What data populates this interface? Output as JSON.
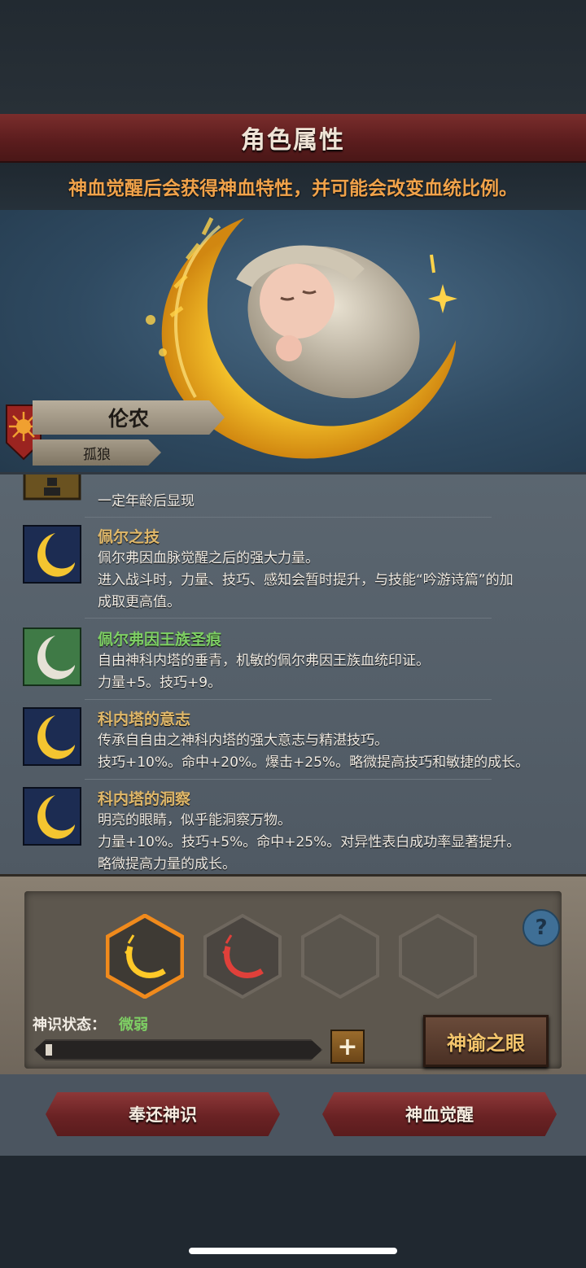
{
  "header": {
    "title": "角色属性",
    "subtitle": "神血觉醒后会获得神血特性，并可能会改变血统比例。"
  },
  "character": {
    "name": "伦农",
    "clan": "孤狼"
  },
  "traits": [
    {
      "name": "",
      "desc_lines": [
        "一定年龄后显现"
      ],
      "icon": "lock-icon"
    },
    {
      "name": "佩尔之技",
      "color": "#e0b86a",
      "icon": "golden-moon-icon",
      "desc_lines": [
        "佩尔弗因血脉觉醒之后的强大力量。",
        "进入战斗时，力量、技巧、感知会暂时提升，与技能“吟游诗篇”的加",
        "成取更高值。"
      ]
    },
    {
      "name": "佩尔弗因王族圣痕",
      "color": "#7ed064",
      "icon": "silver-moon-icon",
      "desc_lines": [
        "自由神科内塔的垂青，机敏的佩尔弗因王族血统印证。",
        "力量+5。技巧+9。"
      ]
    },
    {
      "name": "科内塔的意志",
      "color": "#e0b86a",
      "icon": "golden-moon-icon",
      "desc_lines": [
        "传承自自由之神科内塔的强大意志与精湛技巧。",
        "技巧+10%。命中+20%。爆击+25%。略微提高技巧和敏捷的成长。"
      ]
    },
    {
      "name": "科内塔的洞察",
      "color": "#e0b86a",
      "icon": "golden-moon-icon",
      "desc_lines": [
        "明亮的眼睛，似乎能洞察万物。",
        "力量+10%。技巧+5%。命中+25%。对异性表白成功率显著提升。",
        "略微提高力量的成长。"
      ]
    }
  ],
  "awakening": {
    "state_label": "神识状态：",
    "state_value": "微弱",
    "progress": 0.02,
    "help_label": "?",
    "plus_label": "+",
    "oracle_button": "神谕之眼",
    "slots": [
      "golden-moon-slot",
      "red-moon-slot",
      "empty-slot",
      "empty-slot"
    ]
  },
  "buttons": {
    "return": "奉还神识",
    "awaken": "神血觉醒"
  },
  "colors": {
    "accent": "#f0a24a",
    "gold": "#e0b86a",
    "green": "#7ed064",
    "banner_red": "#6a2224"
  }
}
